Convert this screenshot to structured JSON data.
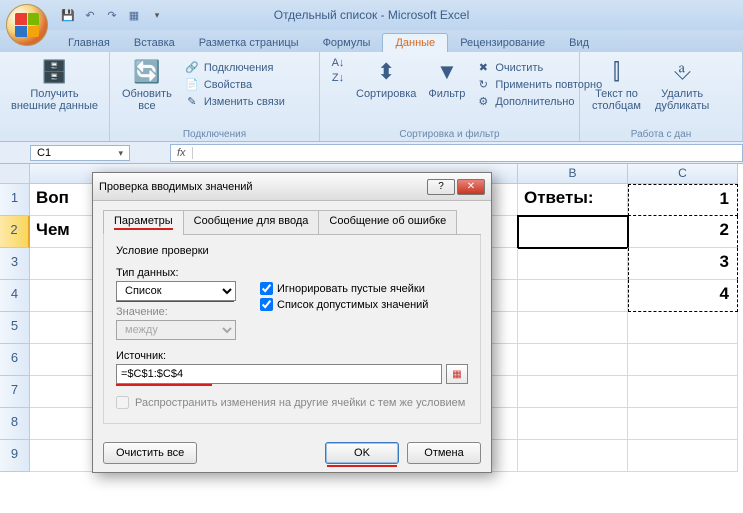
{
  "title": "Отдельный список - Microsoft Excel",
  "qat_icons": [
    "save",
    "undo",
    "redo",
    "quickprint",
    "grid"
  ],
  "tabs": {
    "home": "Главная",
    "insert": "Вставка",
    "pagelayout": "Разметка страницы",
    "formulas": "Формулы",
    "data": "Данные",
    "review": "Рецензирование",
    "view": "Вид"
  },
  "ribbon": {
    "get_external": "Получить\nвнешние данные",
    "refresh": "Обновить\nвсе",
    "connections_group": "Подключения",
    "connections": "Подключения",
    "properties": "Свойства",
    "edit_links": "Изменить связи",
    "sort_az": "А→Я",
    "sort_za": "Я→А",
    "sort": "Сортировка",
    "filter": "Фильтр",
    "clear": "Очистить",
    "reapply": "Применить повторно",
    "advanced": "Дополнительно",
    "sortfilter_group": "Сортировка и фильтр",
    "text_cols": "Текст по\nстолбцам",
    "remove_dup": "Удалить\nдубликаты",
    "datatools_group": "Работа с дан"
  },
  "namebox": "C1",
  "cols": {
    "B": "B",
    "C": "C"
  },
  "rows": {
    "r1": {
      "n": "1",
      "a": "Воп",
      "b": "Ответы:",
      "c": "1"
    },
    "r2": {
      "n": "2",
      "a": "Чем",
      "b": "",
      "c": "2"
    },
    "r3": {
      "n": "3",
      "c": "3"
    },
    "r4": {
      "n": "4",
      "c": "4"
    },
    "r5": {
      "n": "5"
    },
    "r6": {
      "n": "6"
    },
    "r7": {
      "n": "7"
    },
    "r8": {
      "n": "8"
    },
    "r9": {
      "n": "9"
    }
  },
  "dialog": {
    "title": "Проверка вводимых значений",
    "tab_params": "Параметры",
    "tab_input": "Сообщение для ввода",
    "tab_error": "Сообщение об ошибке",
    "cond_title": "Условие проверки",
    "type_label": "Тип данных:",
    "type_value": "Список",
    "ignore_blank": "Игнорировать пустые ячейки",
    "allow_list": "Список допустимых значений",
    "value_label": "Значение:",
    "value_value": "между",
    "source_label": "Источник:",
    "source_value": "=$C$1:$C$4",
    "propagate": "Распространить изменения на другие ячейки с тем же условием",
    "clear_all": "Очистить все",
    "ok": "OK",
    "cancel": "Отмена"
  }
}
